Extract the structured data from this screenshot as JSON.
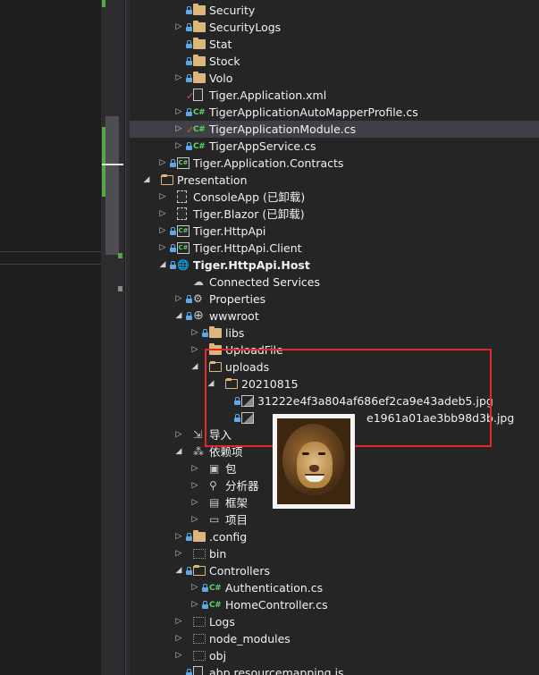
{
  "tree": [
    {
      "label": "Security",
      "icon": "folder-icon",
      "lock": true,
      "arrow": "",
      "indent": 4
    },
    {
      "label": "SecurityLogs",
      "icon": "folder-icon",
      "lock": true,
      "arrow": "collapsed",
      "indent": 4
    },
    {
      "label": "Stat",
      "icon": "folder-icon",
      "lock": true,
      "arrow": "",
      "indent": 4
    },
    {
      "label": "Stock",
      "icon": "folder-icon",
      "lock": true,
      "arrow": "",
      "indent": 4
    },
    {
      "label": "Volo",
      "icon": "folder-icon",
      "lock": true,
      "arrow": "collapsed",
      "indent": 4
    },
    {
      "label": "Tiger.Application.xml",
      "icon": "xml-file-icon",
      "check": true,
      "arrow": "",
      "indent": 4
    },
    {
      "label": "TigerApplicationAutoMapperProfile.cs",
      "icon": "csharp-file-icon",
      "lock": true,
      "arrow": "collapsed",
      "indent": 4
    },
    {
      "label": "TigerApplicationModule.cs",
      "icon": "csharp-file-icon",
      "check": true,
      "arrow": "collapsed",
      "indent": 4,
      "selected": true
    },
    {
      "label": "TigerAppService.cs",
      "icon": "csharp-file-icon",
      "lock": true,
      "arrow": "collapsed",
      "indent": 4
    },
    {
      "label": "Tiger.Application.Contracts",
      "icon": "csharp-project-icon",
      "lock": true,
      "arrow": "collapsed",
      "indent": 3
    },
    {
      "label": "Presentation",
      "icon": "solution-folder-icon",
      "arrow": "expanded",
      "indent": 2
    },
    {
      "label": "ConsoleApp (已卸载)",
      "icon": "unloaded-project-icon",
      "arrow": "collapsed",
      "indent": 3
    },
    {
      "label": "Tiger.Blazor (已卸载)",
      "icon": "unloaded-project-icon",
      "arrow": "collapsed",
      "indent": 3
    },
    {
      "label": "Tiger.HttpApi",
      "icon": "csharp-project-icon",
      "lock": true,
      "arrow": "collapsed",
      "indent": 3
    },
    {
      "label": "Tiger.HttpApi.Client",
      "icon": "csharp-project-icon",
      "lock": true,
      "arrow": "collapsed",
      "indent": 3
    },
    {
      "label": "Tiger.HttpApi.Host",
      "icon": "web-project-icon",
      "lock": true,
      "arrow": "expanded",
      "indent": 3,
      "bold": true
    },
    {
      "label": "Connected Services",
      "icon": "connected-services-icon",
      "arrow": "",
      "indent": 4
    },
    {
      "label": "Properties",
      "icon": "properties-icon",
      "lock": true,
      "arrow": "collapsed",
      "indent": 4
    },
    {
      "label": "wwwroot",
      "icon": "globe-icon",
      "lock": true,
      "arrow": "expanded",
      "indent": 4
    },
    {
      "label": "libs",
      "icon": "folder-icon",
      "lock": true,
      "arrow": "collapsed",
      "indent": 5
    },
    {
      "label": "UploadFile",
      "icon": "folder-icon",
      "arrow": "collapsed",
      "indent": 5
    },
    {
      "label": "uploads",
      "icon": "open-folder-icon",
      "arrow": "expanded",
      "indent": 5
    },
    {
      "label": "20210815",
      "icon": "open-folder-icon",
      "arrow": "expanded",
      "indent": 6
    },
    {
      "label": "31222e4f3a804af686ef2ca9e43adeb5.jpg",
      "icon": "image-file-icon",
      "lock": true,
      "arrow": "",
      "indent": 7
    },
    {
      "label": "e1961a01ae3bb98d3b.jpg",
      "icon": "image-file-icon",
      "lock": true,
      "arrow": "",
      "indent": 7,
      "label_offset": 122
    },
    {
      "label": "导入",
      "icon": "import-icon",
      "arrow": "collapsed",
      "indent": 4
    },
    {
      "label": "依赖项",
      "icon": "dependencies-icon",
      "arrow": "expanded",
      "indent": 4
    },
    {
      "label": "包",
      "icon": "package-icon",
      "arrow": "collapsed",
      "indent": 5
    },
    {
      "label": "分析器",
      "icon": "analyzer-icon",
      "arrow": "collapsed",
      "indent": 5
    },
    {
      "label": "框架",
      "icon": "framework-icon",
      "arrow": "collapsed",
      "indent": 5
    },
    {
      "label": "项目",
      "icon": "project-ref-icon",
      "arrow": "collapsed",
      "indent": 5
    },
    {
      "label": ".config",
      "icon": "folder-icon",
      "lock": true,
      "arrow": "collapsed",
      "indent": 4
    },
    {
      "label": "bin",
      "icon": "dotted-folder-icon",
      "arrow": "collapsed",
      "indent": 4
    },
    {
      "label": "Controllers",
      "icon": "open-folder-icon",
      "lock": true,
      "arrow": "expanded",
      "indent": 4
    },
    {
      "label": "Authentication.cs",
      "icon": "csharp-file-icon",
      "lock": true,
      "arrow": "collapsed",
      "indent": 5
    },
    {
      "label": "HomeController.cs",
      "icon": "csharp-file-icon",
      "lock": true,
      "arrow": "collapsed",
      "indent": 5
    },
    {
      "label": "Logs",
      "icon": "dotted-folder-icon",
      "arrow": "collapsed",
      "indent": 4
    },
    {
      "label": "node_modules",
      "icon": "dotted-folder-icon",
      "arrow": "collapsed",
      "indent": 4
    },
    {
      "label": "obj",
      "icon": "dotted-folder-icon",
      "arrow": "collapsed",
      "indent": 4
    },
    {
      "label": "abp.resourcemapping.js",
      "icon": "js-file-icon",
      "lock": true,
      "arrow": "",
      "indent": 4
    }
  ],
  "colors": {
    "highlight_box": "#e0282e",
    "folder": "#dcb67a",
    "csharp": "#61d06c",
    "lock": "#5fa8e8",
    "checkmark": "#e05050"
  },
  "preview": {
    "icon": "lion-image-thumbnail"
  }
}
